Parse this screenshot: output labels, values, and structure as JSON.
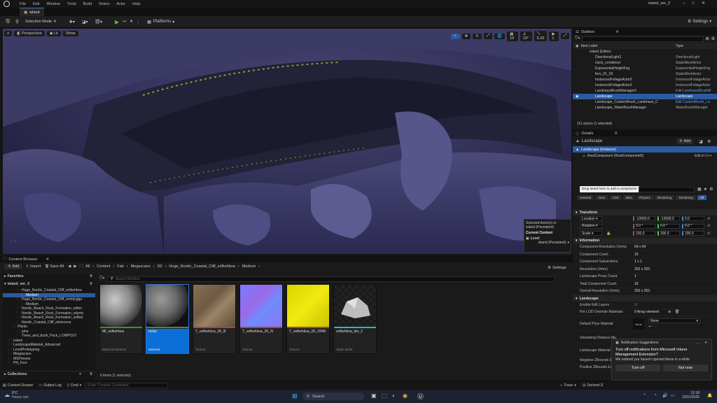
{
  "menu": {
    "items": [
      "File",
      "Edit",
      "Window",
      "Tools",
      "Build",
      "Select",
      "Actor",
      "Help"
    ],
    "project_title": "island_ver_2"
  },
  "tab": {
    "label": "island"
  },
  "toolbar": {
    "selection_mode": "Selection Mode",
    "platforms": "Platforms",
    "settings": "Settings"
  },
  "viewport": {
    "perspective": "Perspective",
    "lit": "Lit",
    "show": "Show",
    "grid_snap": "10",
    "rot_snap": "10°",
    "scale_snap": "0.25",
    "cam_speed": "1",
    "selected_info": "Selected Actor(s) in",
    "selected_level": "island (Persistent)",
    "current_context": "Current Context",
    "level_label": "Level",
    "level_value": "island (Persistent)"
  },
  "content_browser": {
    "title": "Content Browser",
    "add": "Add",
    "import": "Import",
    "save_all": "Save All",
    "settings": "Settings",
    "path": [
      "All",
      "Content",
      "Fab",
      "Megascans",
      "3D",
      "Huge_Nordic_Coastal_Cliff_vefkehbva",
      "Medium"
    ],
    "favorites": "Favorites",
    "root": "island_ver_2",
    "tree": [
      "Huge_Nordic_Coastal_Cliff_vefkehbva",
      "Medium",
      "Huge_Nordic_Coastal_Cliff_vemdcgga",
      "Medium",
      "Nordic_Beach_Rock_Formation_vdfeo",
      "Nordic_Beach_Rock_Formation_vdyms",
      "Nordic_Beach_Rock_Formation_vefbal",
      "Nordic_Coastal_Cliff_slmicceva",
      "Plants",
      "pine",
      "Trees_and_bush_Pack_LOWPOLY",
      "island",
      "LandscapeMaterial_Advanced",
      "LevelPrototyping",
      "Megascans",
      "MSPresets",
      "PN_Fern"
    ],
    "collections": "Collections",
    "search_placeholder": "Search Medium",
    "items_count": "6 items (1 selected)",
    "assets": [
      {
        "name": "MI_vefkehbva",
        "type": "Material Instance"
      },
      {
        "name": "rocks",
        "type": "Material"
      },
      {
        "name": "T_vefkehbva_2K_B",
        "type": "Texture"
      },
      {
        "name": "T_vefkehbva_2K_N",
        "type": "Texture"
      },
      {
        "name": "T_vefkehbva_2K_ORM",
        "type": "Texture"
      },
      {
        "name": "vefkehbva_tier_2",
        "type": "Static Mesh"
      }
    ]
  },
  "outliner": {
    "title": "Outliner",
    "col_label": "Item Label",
    "col_type": "Type",
    "rows": [
      {
        "name": "island (Editor)",
        "type": ""
      },
      {
        "name": "DirectionalLight2",
        "type": "DirectionalLight"
      },
      {
        "name": "clock_combined",
        "type": "StaticMeshActor"
      },
      {
        "name": "ExponentialHeightFog",
        "type": "ExponentialHeightFog"
      },
      {
        "name": "fern_01_03",
        "type": "StaticMeshActor"
      },
      {
        "name": "InstancedFoliageActor0",
        "type": "InstancedFoliageActor"
      },
      {
        "name": "InstancedFoliageActor3",
        "type": "InstancedFoliageActor"
      },
      {
        "name": "LandmassBrushManager0",
        "type": "Edit LandmassBrushM"
      },
      {
        "name": "Landscape",
        "type": "Landscape"
      },
      {
        "name": "Landscape_CustomBrush_Landmass_C",
        "type": "Edit CustomBrush_La"
      },
      {
        "name": "Landscape_WaterBrushManager",
        "type": "WaterBrushManager"
      }
    ],
    "footer": "111 actors (1 selected)"
  },
  "details": {
    "title": "Details",
    "object": "Landscape",
    "add": "Add",
    "instance": "Landscape (Instance)",
    "root_component": "RootComponent (RootComponent0)",
    "edit_cpp": "Edit in C++",
    "tooltip": "Drop asset here to add a component.",
    "filters": [
      "General",
      "Actor",
      "LOD",
      "Misc",
      "Physics",
      "Rendering",
      "Streaming",
      "All"
    ],
    "transform": "Transform",
    "location": {
      "label": "Location",
      "x": "-12600.0",
      "y": "-12600.0",
      "z": "0.0"
    },
    "rotation": {
      "label": "Rotation",
      "x": "0.0 °",
      "y": "0.0 °",
      "z": "0.0 °"
    },
    "scale": {
      "label": "Scale",
      "x": "100.0",
      "y": "100.0",
      "z": "100.0"
    },
    "information": "Information",
    "info_rows": [
      {
        "l": "Component Resolution (Verts)",
        "v": "64 x 64"
      },
      {
        "l": "Component Count",
        "v": "16"
      },
      {
        "l": "Component Subsections",
        "v": "1 x 1"
      },
      {
        "l": "Resolution (Verts)",
        "v": "253 x 253"
      },
      {
        "l": "Landscape Proxy Count",
        "v": "1"
      },
      {
        "l": "Total Component Count",
        "v": "16"
      },
      {
        "l": "Overall Resolution (Verts)",
        "v": "253 x 253"
      }
    ],
    "landscape": "Landscape",
    "edit_layers": "Enable Edit Layers",
    "per_lod": "Per LOD Override Materials",
    "per_lod_value": "0 Array element",
    "default_phys": "Default Phys Material",
    "none": "None",
    "streaming_dist": "Streaming Distance Mu",
    "landscape_material": "Landscape Material",
    "neg_z": "Negative ZBounds Exte",
    "pos_z": "Positive ZBounds Exten"
  },
  "notification": {
    "header": "Notification Suggestions",
    "title": "Turn off notifications from Microsoft Intune Management Extension?",
    "body": "We noticed you haven't opened these in a while.",
    "turn_off": "Turn off",
    "not_now": "Not now"
  },
  "statusbar": {
    "drawer": "Content Drawer",
    "output": "Output Log",
    "cmd": "Cmd",
    "console_placeholder": "Enter Console Command",
    "trace": "Trace",
    "derived": "Derived D"
  },
  "taskbar": {
    "weather_temp": "8°C",
    "weather_desc": "Heavy rain",
    "search": "Search",
    "time": "12:18",
    "date": "23/01/2025"
  }
}
